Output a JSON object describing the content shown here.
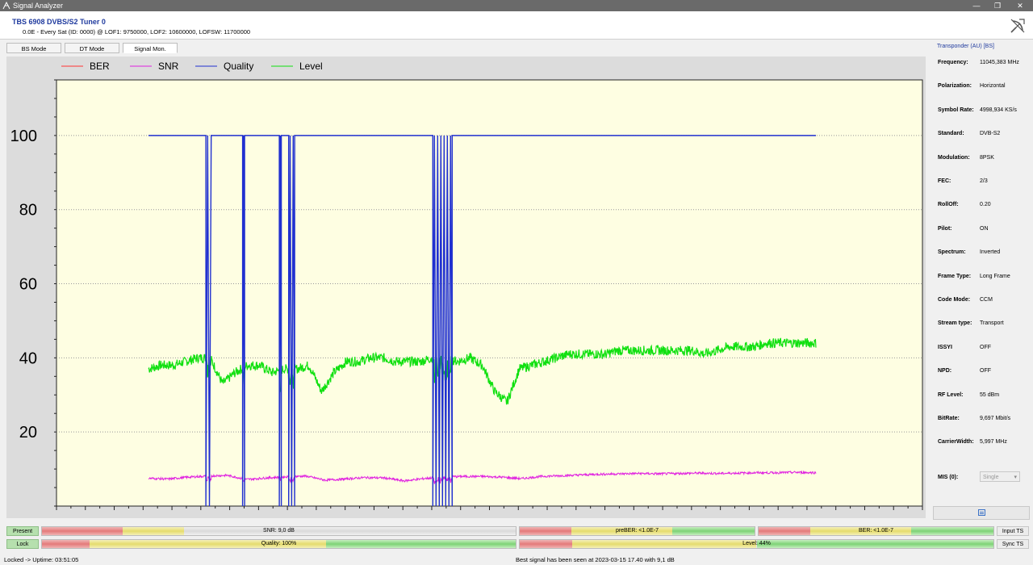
{
  "window": {
    "title": "Signal Analyzer",
    "minimize": "—",
    "maximize": "❐",
    "close": "✕"
  },
  "header": {
    "device": "TBS 6908 DVBS/S2 Tuner 0",
    "info": "0.0E - Every Sat (ID: 0000) @ LOF1: 9750000, LOF2: 10600000, LOFSW: 11700000"
  },
  "tabs": [
    {
      "label": "BS Mode",
      "active": false
    },
    {
      "label": "DT Mode",
      "active": false
    },
    {
      "label": "Signal Mon.",
      "active": true
    }
  ],
  "legend": [
    {
      "name": "BER",
      "color": "#ff3333"
    },
    {
      "name": "SNR",
      "color": "#e020e0"
    },
    {
      "name": "Quality",
      "color": "#2030d0"
    },
    {
      "name": "Level",
      "color": "#10e010"
    }
  ],
  "chart_data": {
    "type": "line",
    "ylim": [
      0,
      115
    ],
    "y_ticks": [
      "20",
      "40",
      "60",
      "80",
      "100"
    ],
    "y_tick_values": [
      20,
      40,
      60,
      80,
      100
    ],
    "grid": "horizontal dotted",
    "background": "#fefee2",
    "x_start": 0,
    "x_end": 100,
    "series": [
      {
        "name": "Quality",
        "color": "#2030d0",
        "values": [
          100,
          100,
          100,
          100,
          100,
          100,
          100,
          100,
          100,
          100,
          100,
          100,
          100,
          100,
          100,
          100,
          100,
          100,
          100,
          100,
          100,
          100,
          100,
          100,
          100,
          100,
          100,
          100,
          100,
          100,
          100,
          100,
          100,
          100,
          100,
          100,
          100,
          100,
          100,
          100,
          100,
          100,
          100,
          100,
          100,
          100,
          100,
          100,
          100,
          100
        ],
        "dropouts": [
          [
            8.6,
            9.4
          ],
          [
            14.1,
            14.4
          ],
          [
            19.6,
            19.9
          ],
          [
            21.0,
            21.9
          ],
          [
            42.6,
            45.5
          ]
        ]
      },
      {
        "name": "Level",
        "color": "#10e010",
        "values": [
          37,
          38,
          38,
          39,
          40,
          40,
          33,
          36,
          38,
          38,
          36,
          37,
          37,
          38,
          31,
          36,
          39,
          39,
          40,
          40,
          39,
          39,
          39,
          40,
          40,
          39,
          40,
          38,
          31,
          28,
          37,
          38,
          39,
          40,
          41,
          41,
          41,
          41,
          42,
          42,
          42,
          42,
          42,
          42,
          42,
          41,
          42,
          43,
          43,
          43,
          44,
          44,
          44,
          44,
          44
        ]
      },
      {
        "name": "SNR",
        "color": "#e020e0",
        "values": [
          7.5,
          7.3,
          7.8,
          8.1,
          8.3,
          7.2,
          7.6,
          7.9,
          8.1,
          7.0,
          7.3,
          7.7,
          7.6,
          6.8,
          7.4,
          7.9,
          8.0,
          8.0,
          7.8,
          7.4,
          8.0,
          8.2,
          8.4,
          8.6,
          8.7,
          8.8,
          8.7,
          8.8,
          8.9,
          8.8,
          8.9,
          9.0,
          9.0,
          9.1,
          9.0
        ]
      },
      {
        "name": "BER",
        "color": "#ff3333",
        "values": []
      }
    ]
  },
  "transponder": {
    "title": "Transponder (AU) [BS]",
    "rows": [
      {
        "label": "Frequency:",
        "value": "11045,383 MHz"
      },
      {
        "label": "Polarization:",
        "value": "Horizontal"
      },
      {
        "label": "Symbol Rate:",
        "value": "4998,934 KS/s"
      },
      {
        "label": "Standard:",
        "value": "DVB-S2"
      },
      {
        "label": "Modulation:",
        "value": "8PSK"
      },
      {
        "label": "FEC:",
        "value": "2/3"
      },
      {
        "label": "RollOff:",
        "value": "0.20"
      },
      {
        "label": "Pilot:",
        "value": "ON"
      },
      {
        "label": "Spectrum:",
        "value": "Inverted"
      },
      {
        "label": "Frame Type:",
        "value": "Long Frame"
      },
      {
        "label": "Code Mode:",
        "value": "CCM"
      },
      {
        "label": "Stream type:",
        "value": "Transport"
      },
      {
        "label": "ISSYI",
        "value": "OFF"
      },
      {
        "label": "NPD:",
        "value": "OFF"
      },
      {
        "label": "RF Level:",
        "value": "55 dBm"
      },
      {
        "label": "BitRate:",
        "value": "9,697 Mbit/s"
      },
      {
        "label": "CarrierWidth:",
        "value": "5,997 MHz"
      }
    ],
    "mis_label": "MIS (0):",
    "mis_value": "Single"
  },
  "status": {
    "present": "Present",
    "lock": "Lock",
    "snr": {
      "text": "SNR: 9,0 dB",
      "fill": 0.3
    },
    "quality": {
      "text": "Quality: 100%",
      "fill": 1.0
    },
    "prebet": {
      "text": "preBER: <1.0E-7",
      "fill": 1.0
    },
    "level": {
      "text": "Level: 44%",
      "fill": 0.44
    },
    "ber": {
      "text": "BER: <1.0E-7",
      "fill": 1.0
    },
    "input_ts": "Input TS",
    "sync_ts": "Sync TS"
  },
  "bottom": {
    "uptime": "Locked -> Uptime: 03:51:05",
    "best": "Best signal has been seen at 2023-03-15 17.40 with 9,1 dB"
  }
}
